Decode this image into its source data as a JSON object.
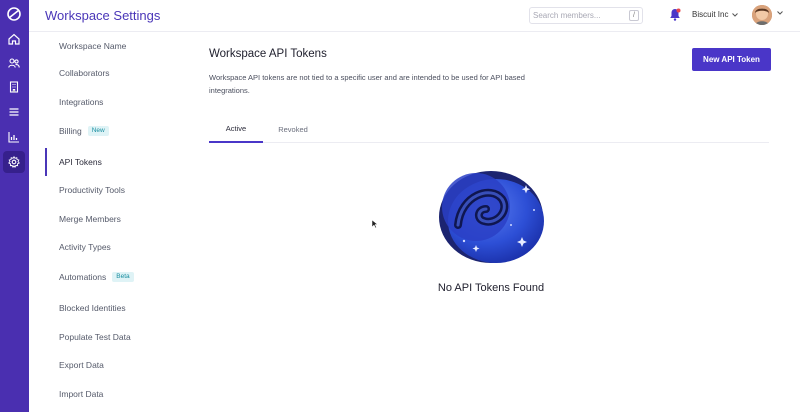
{
  "header": {
    "title": "Workspace Settings",
    "search_placeholder": "Search members...",
    "search_shortcut": "/",
    "org_name": "Biscuit Inc"
  },
  "rail": {
    "icons": [
      "logo-icon",
      "home-icon",
      "people-icon",
      "building-icon",
      "list-icon",
      "chart-icon",
      "gear-icon"
    ]
  },
  "settings_nav": {
    "items": [
      {
        "label": "Workspace Name"
      },
      {
        "label": "Collaborators"
      },
      {
        "label": "Integrations"
      },
      {
        "label": "Billing",
        "badge": "New"
      },
      {
        "label": "API Tokens"
      },
      {
        "label": "Productivity Tools"
      },
      {
        "label": "Merge Members"
      },
      {
        "label": "Activity Types"
      },
      {
        "label": "Automations",
        "badge": "Beta"
      },
      {
        "label": "Blocked Identities"
      },
      {
        "label": "Populate Test Data"
      },
      {
        "label": "Export Data"
      },
      {
        "label": "Import Data"
      }
    ],
    "active_index": 4
  },
  "main": {
    "title": "Workspace API Tokens",
    "description": "Workspace API tokens are not tied to a specific user and are intended to be used for API based integrations.",
    "new_token_label": "New API Token",
    "tabs": [
      {
        "label": "Active"
      },
      {
        "label": "Revoked"
      }
    ],
    "active_tab": 0,
    "empty_message": "No API Tokens Found"
  },
  "colors": {
    "brand": "#4a36c8",
    "rail": "#4a2fb0"
  }
}
